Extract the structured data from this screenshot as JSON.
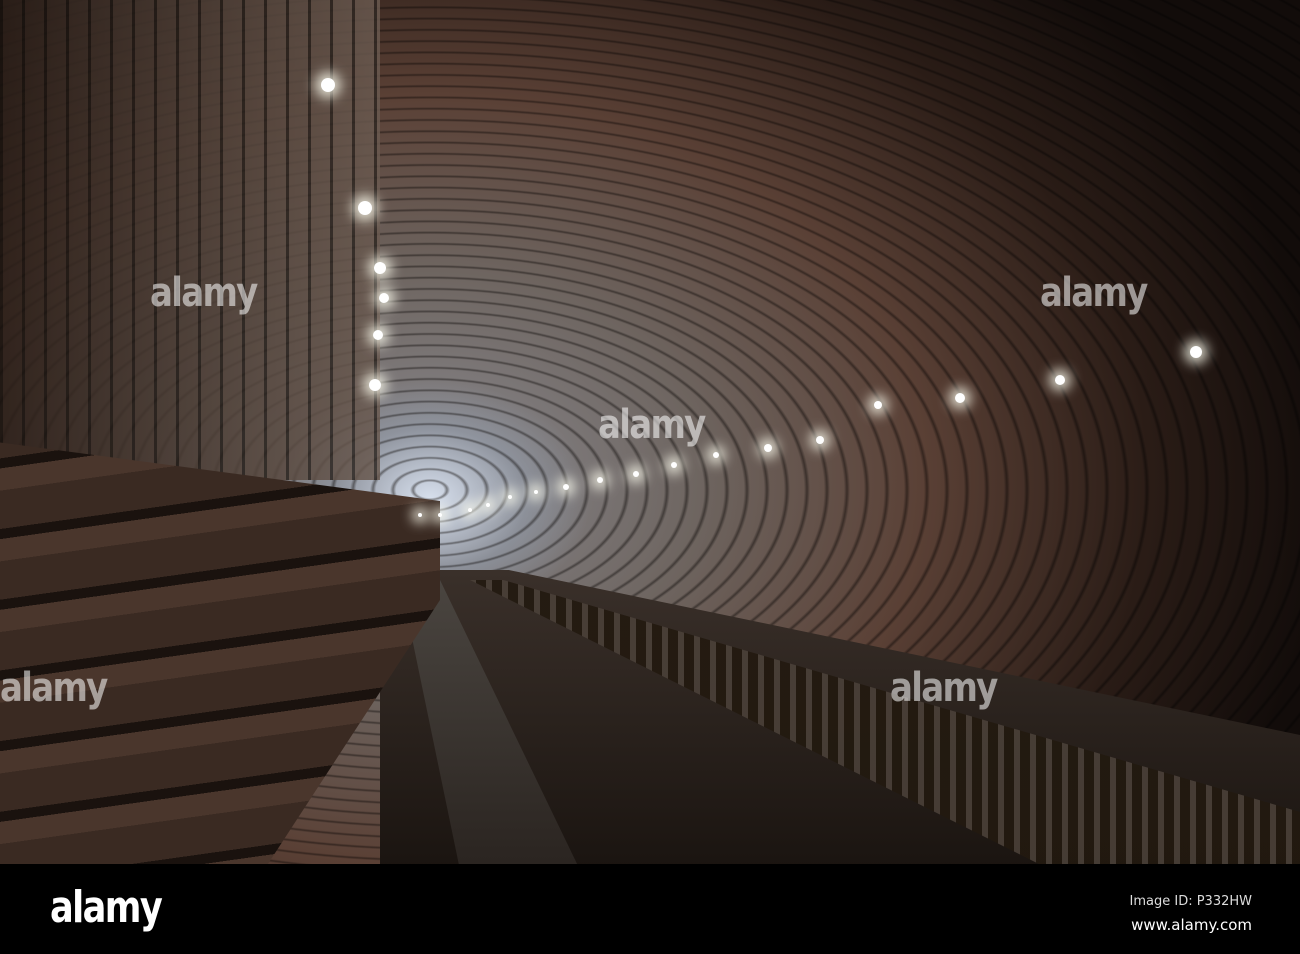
{
  "watermark": "alamy",
  "footer": {
    "logo": "alamy",
    "image_id": "Image ID: P332HW",
    "url": "www.alamy.com"
  }
}
